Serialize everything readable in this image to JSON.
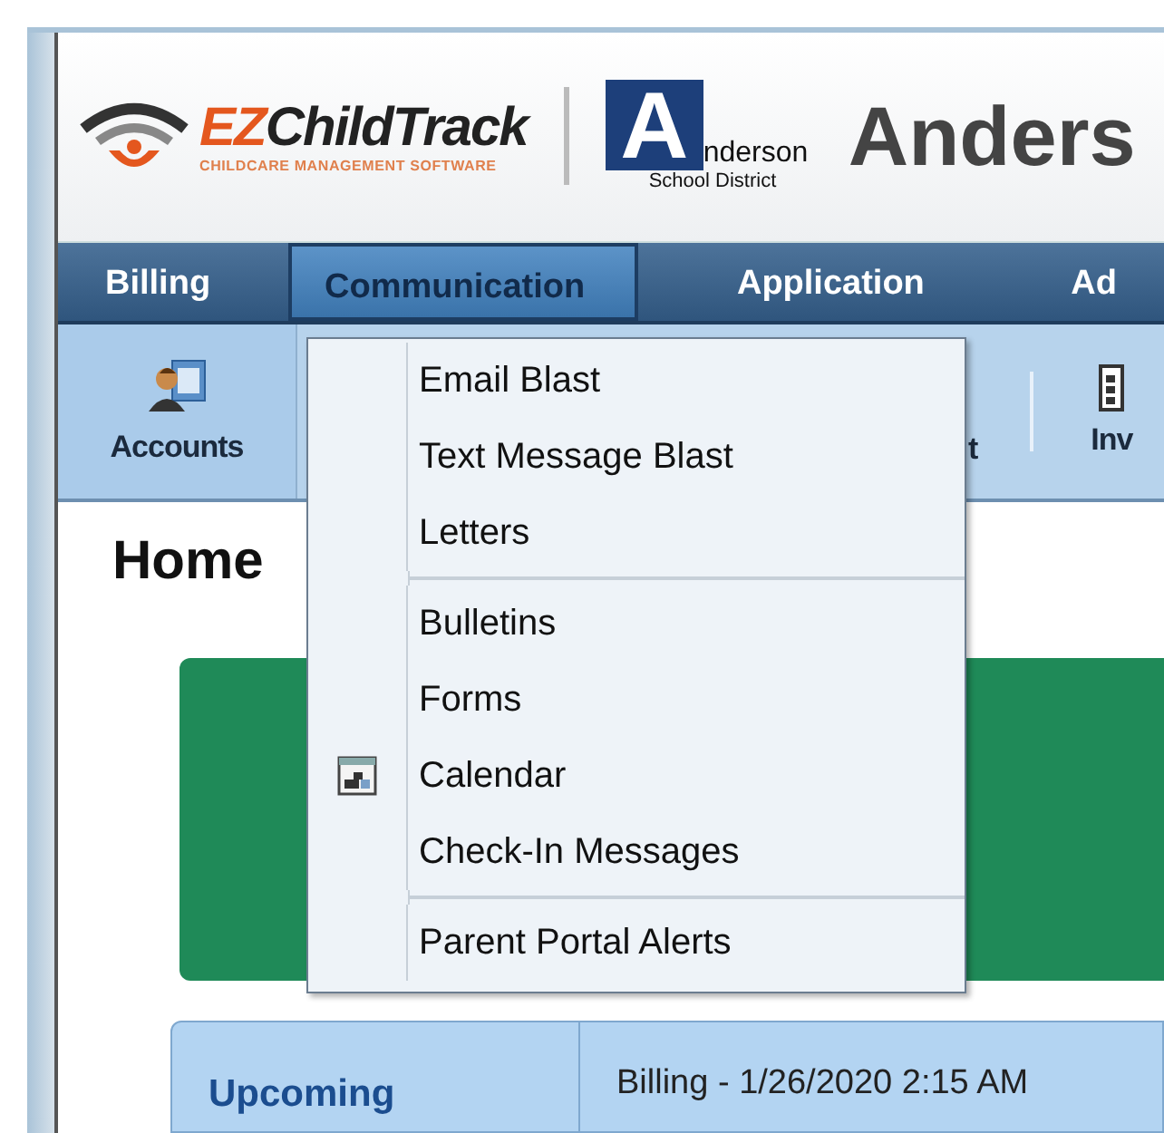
{
  "header": {
    "brand_prefix": "EZ",
    "brand_name": "ChildTrack",
    "tagline": "CHILDCARE MANAGEMENT SOFTWARE",
    "district_letter": "A",
    "district_rest": "nderson",
    "district_sub": "School District",
    "district_title": "Anders"
  },
  "nav": [
    {
      "label": "Billing",
      "selected": false
    },
    {
      "label": "Communication",
      "selected": true
    },
    {
      "label": "Application",
      "selected": false
    },
    {
      "label": "Ad",
      "selected": false
    }
  ],
  "toolbar": [
    {
      "label": "Accounts",
      "kind": "accounts"
    },
    {
      "label": "t",
      "kind": "hidden"
    },
    {
      "label": "Inv",
      "kind": "invoice"
    }
  ],
  "page_title": "Home",
  "upcoming": {
    "heading": "Upcoming",
    "entry": "Billing - 1/26/2020 2:15 AM"
  },
  "menu": {
    "groups": [
      [
        {
          "label": "Email Blast",
          "kind": "plain"
        },
        {
          "label": "Text Message Blast",
          "kind": "plain"
        },
        {
          "label": "Letters",
          "kind": "plain"
        }
      ],
      [
        {
          "label": "Bulletins",
          "kind": "plain"
        },
        {
          "label": "Forms",
          "kind": "plain"
        },
        {
          "label": "Calendar",
          "kind": "with-icon"
        },
        {
          "label": "Check-In Messages",
          "kind": "plain"
        }
      ],
      [
        {
          "label": "Parent Portal Alerts",
          "kind": "plain"
        }
      ]
    ]
  }
}
